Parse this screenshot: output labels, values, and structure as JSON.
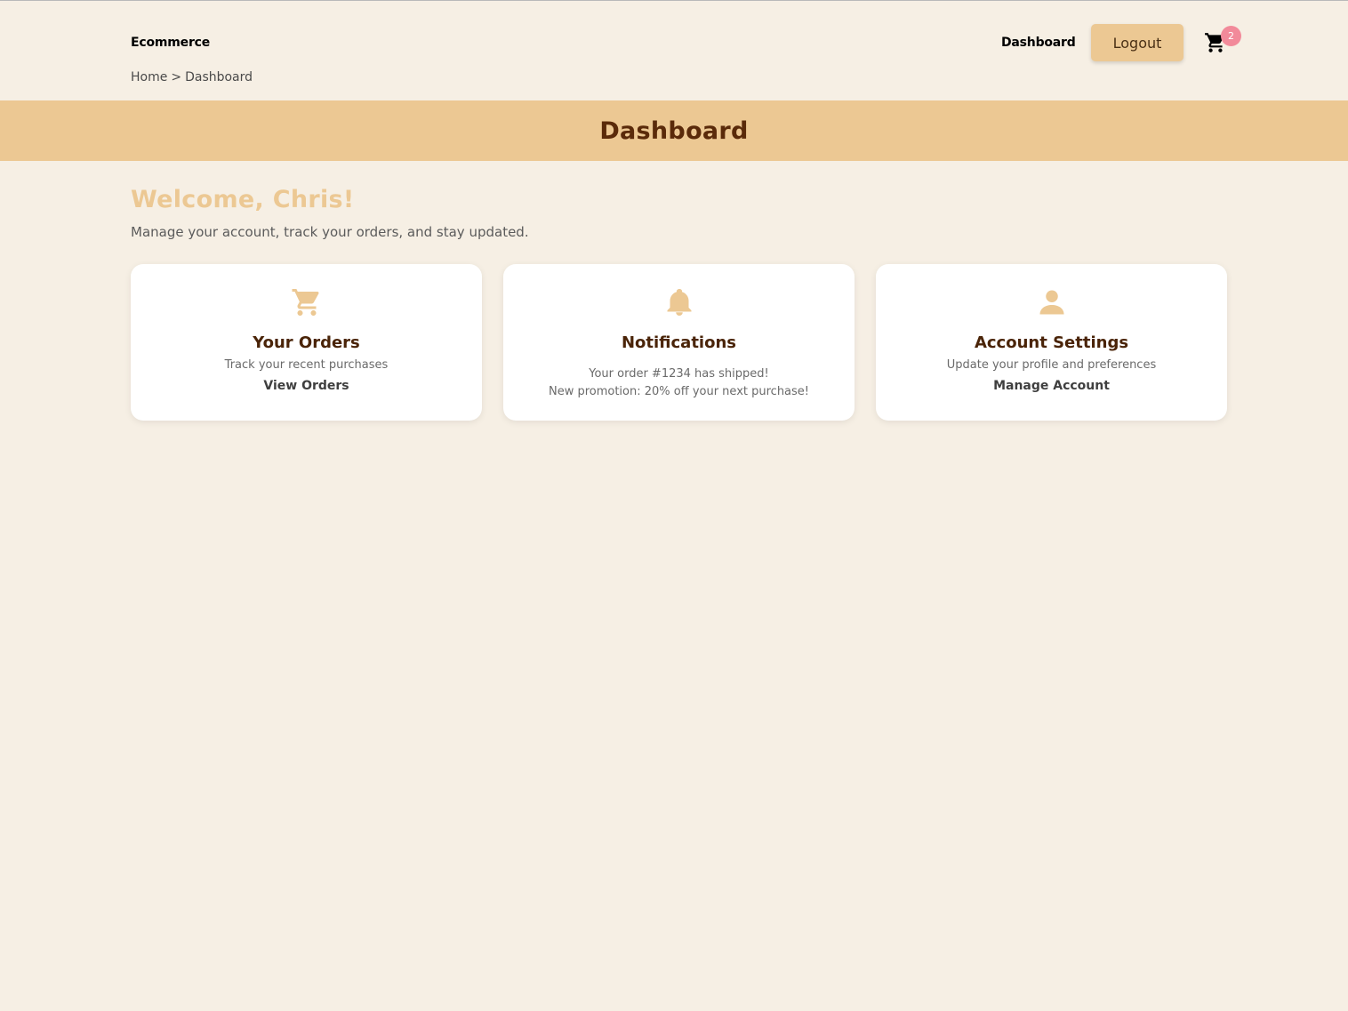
{
  "header": {
    "brand": "Ecommerce",
    "nav_dashboard": "Dashboard",
    "logout_label": "Logout",
    "cart_count": "2",
    "cart_icon": "cart-icon"
  },
  "breadcrumb": {
    "home": "Home",
    "separator": ">",
    "current": "Dashboard"
  },
  "banner": {
    "title": "Dashboard"
  },
  "welcome": {
    "title": "Welcome, Chris!",
    "subtitle": "Manage your account, track your orders, and stay updated."
  },
  "cards": {
    "orders": {
      "icon": "cart-icon",
      "title": "Your Orders",
      "description": "Track your recent purchases",
      "link": "View Orders"
    },
    "notifications": {
      "icon": "bell-icon",
      "title": "Notifications",
      "items": [
        "Your order #1234 has shipped!",
        "New promotion: 20% off your next purchase!"
      ]
    },
    "account": {
      "icon": "user-icon",
      "title": "Account Settings",
      "description": "Update your profile and preferences",
      "link": "Manage Account"
    }
  },
  "colors": {
    "background": "#f6efe4",
    "accent": "#ecc893",
    "heading_brown": "#5a2a0a",
    "badge": "#f28a9a",
    "card": "#ffffff"
  }
}
